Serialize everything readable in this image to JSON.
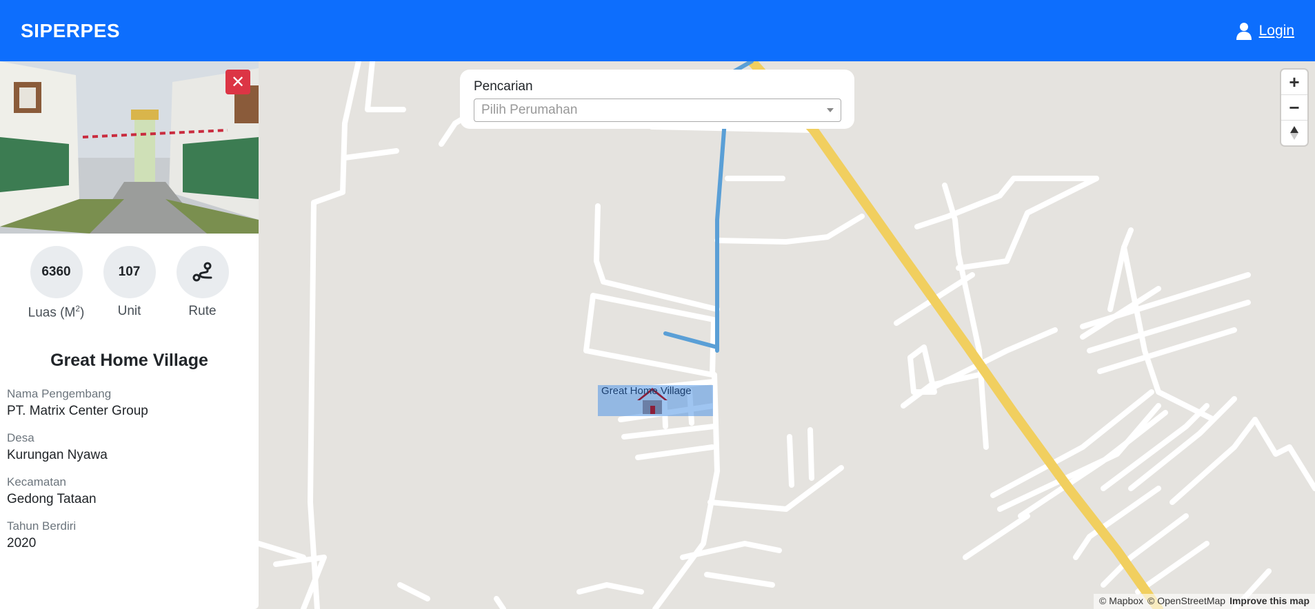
{
  "navbar": {
    "brand": "SIPERPES",
    "login": "Login"
  },
  "sidebar": {
    "stats": [
      {
        "value": "6360",
        "label": "Luas (M",
        "label_sup": "2",
        "label_end": ")"
      },
      {
        "value": "107",
        "label": "Unit"
      },
      {
        "icon": "route-icon",
        "label": "Rute"
      }
    ],
    "house_name": "Great Home Village",
    "details": [
      {
        "label": "Nama Pengembang",
        "value": "PT. Matrix Center Group"
      },
      {
        "label": "Desa",
        "value": "Kurungan Nyawa"
      },
      {
        "label": "Kecamatan",
        "value": "Gedong Tataan"
      },
      {
        "label": "Tahun Berdiri",
        "value": "2020"
      }
    ]
  },
  "search": {
    "title": "Pencarian",
    "placeholder": "Pilih Perumahan"
  },
  "map": {
    "marker_label": "Great Home Village",
    "attribution": {
      "mapbox": "© Mapbox",
      "osm": "© OpenStreetMap",
      "improve": "Improve this map"
    }
  },
  "colors": {
    "navbar": "#0d6efd",
    "close_button": "#dc3545",
    "highway": "#f1cf5f",
    "route": "#5a9fd6"
  }
}
